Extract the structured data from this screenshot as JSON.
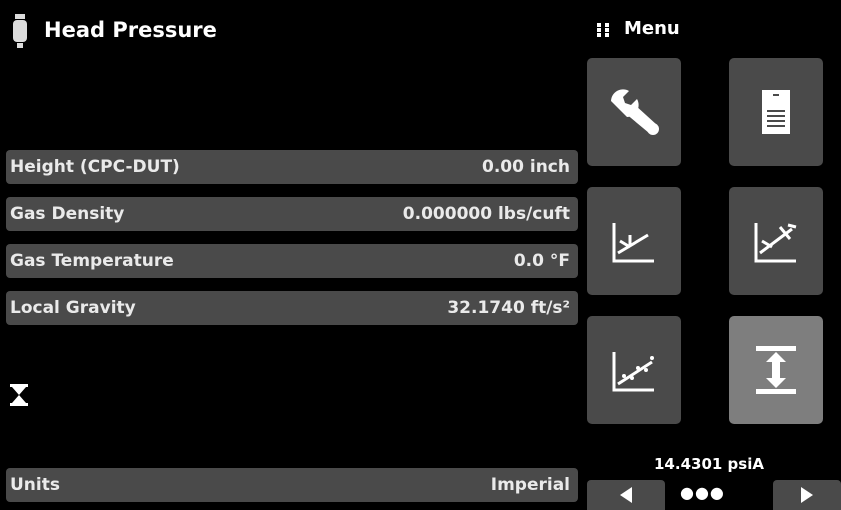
{
  "header": {
    "title": "Head Pressure",
    "icon": "sensor-icon"
  },
  "menu": {
    "label": "Menu",
    "icon": "grip-icon"
  },
  "parameters": [
    {
      "label": "Height (CPC-DUT)",
      "value": "0.00 inch"
    },
    {
      "label": "Gas Density",
      "value": "0.000000 lbs/cuft"
    },
    {
      "label": "Gas Temperature",
      "value": "0.0 °F"
    },
    {
      "label": "Local Gravity",
      "value": "32.1740 ft/s²"
    }
  ],
  "units": {
    "label": "Units",
    "value": "Imperial"
  },
  "status": {
    "icon": "hourglass-icon"
  },
  "tiles": [
    {
      "name": "settings-tile",
      "icon": "wrench-icon",
      "active": false
    },
    {
      "name": "info-tile",
      "icon": "document-icon",
      "active": false
    },
    {
      "name": "zero-tile",
      "icon": "zero-graph-icon",
      "active": false
    },
    {
      "name": "span-tile",
      "icon": "span-graph-icon",
      "active": false
    },
    {
      "name": "calibration-tile",
      "icon": "linearization-graph-icon",
      "active": false
    },
    {
      "name": "head-pressure-tile",
      "icon": "head-pressure-icon",
      "active": true
    }
  ],
  "footer": {
    "pressure": "14.4301 psiA",
    "page_dots": "●●●",
    "current_page": 3,
    "page_count": 3
  },
  "colors": {
    "background": "#000000",
    "panel": "#4a4a4a",
    "active_tile": "#7e7e7e",
    "text": "#ffffff"
  }
}
